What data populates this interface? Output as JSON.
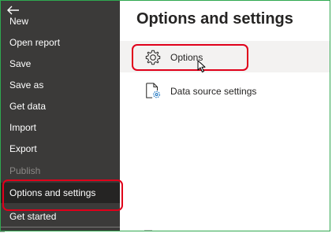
{
  "sidebar": {
    "items": [
      {
        "label": "New"
      },
      {
        "label": "Open report"
      },
      {
        "label": "Save"
      },
      {
        "label": "Save as"
      },
      {
        "label": "Get data"
      },
      {
        "label": "Import"
      },
      {
        "label": "Export"
      },
      {
        "label": "Publish",
        "disabled": true
      },
      {
        "label": "Options and settings",
        "selected": true
      },
      {
        "label": "Get started"
      }
    ]
  },
  "main": {
    "title": "Options and settings",
    "options": [
      {
        "label": "Options",
        "icon": "gear-icon"
      },
      {
        "label": "Data source settings",
        "icon": "data-source-gear-icon"
      }
    ]
  },
  "colors": {
    "sidebar_bg": "#3b3a39",
    "selected_bg": "#252423",
    "highlight_border": "#e0001a",
    "frame": "#2fa84f"
  }
}
